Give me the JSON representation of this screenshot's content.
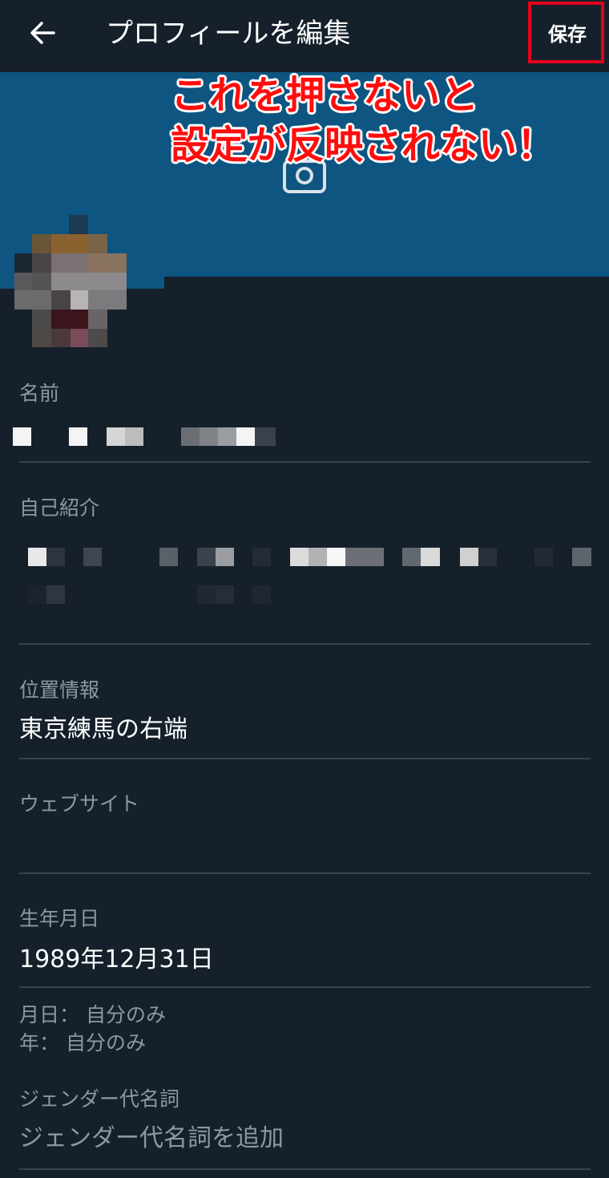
{
  "header": {
    "title": "プロフィールを編集",
    "back_icon": "arrow-left-icon",
    "save_label": "保存"
  },
  "annotation": {
    "line1": "これを押さないと",
    "line2": "設定が反映されない！",
    "color": "#ff0d0d"
  },
  "banner": {
    "color": "#0e5581",
    "camera_icon": "camera-icon"
  },
  "fields": {
    "name": {
      "label": "名前"
    },
    "bio": {
      "label": "自己紹介"
    },
    "location": {
      "label": "位置情報",
      "value": "東京練馬の右端"
    },
    "website": {
      "label": "ウェブサイト",
      "value": ""
    },
    "birthday": {
      "label": "生年月日",
      "value": "1989年12月31日"
    },
    "birthday_privacy": {
      "month_day": "月日： 自分のみ",
      "year": "年： 自分のみ"
    },
    "gender": {
      "label": "ジェンダー代名詞",
      "placeholder": "ジェンダー代名詞を追加"
    }
  },
  "colors": {
    "background": "#15202b",
    "label": "#8b98a5",
    "divider": "#38444d",
    "highlight_box": "#e3001b"
  }
}
